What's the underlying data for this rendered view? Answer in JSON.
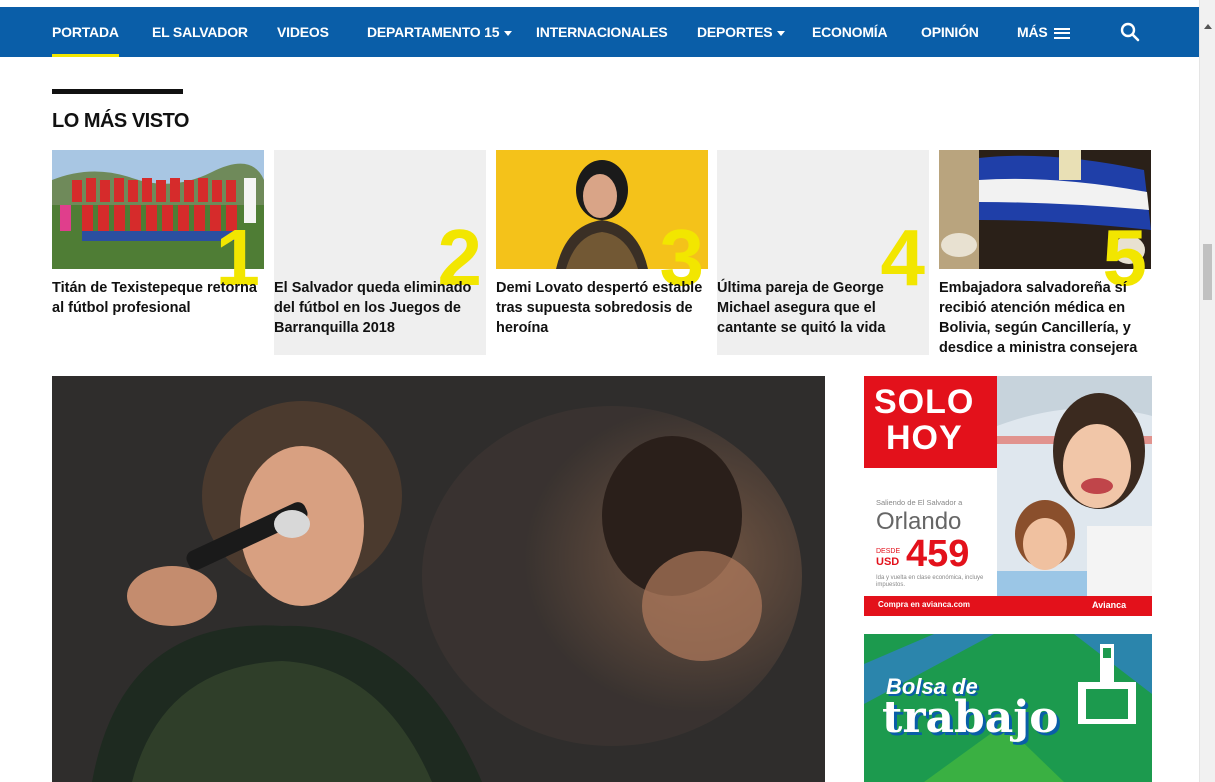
{
  "nav": {
    "items": [
      "PORTADA",
      "EL SALVADOR",
      "VIDEOS",
      "DEPARTAMENTO 15",
      "INTERNACIONALES",
      "DEPORTES",
      "ECONOMÍA",
      "OPINIÓN",
      "MÁS"
    ],
    "active": "PORTADA"
  },
  "section": {
    "title": "LO MÁS VISTO"
  },
  "cards": [
    {
      "rank": "1",
      "caption": "Titán de Texistepeque retorna al fútbol profesional"
    },
    {
      "rank": "2",
      "caption": "El Salvador queda eliminado del fútbol en los Juegos de Barranquilla 2018"
    },
    {
      "rank": "3",
      "caption": "Demi Lovato despertó estable tras supuesta sobredosis de heroína"
    },
    {
      "rank": "4",
      "caption": "Última pareja de George Michael asegura que el cantante se quitó la vida"
    },
    {
      "rank": "5",
      "caption": "Embajadora salvadoreña sí recibió atención médica en Bolivia, según Cancillería, y desdice a ministra consejera"
    }
  ],
  "ads": {
    "avianca": {
      "headline_1": "SOLO",
      "headline_2": "HOY",
      "route": "Saliendo de El Salvador a",
      "city": "Orlando",
      "from_label": "DESDE",
      "currency": "USD",
      "price": "459",
      "fine_print": "Ida y vuelta en clase económica, incluye impuestos.",
      "cta": "Compra en avianca.com",
      "brand": "Avianca"
    },
    "bolsa": {
      "line_1": "Bolsa de",
      "line_2": "trabajo"
    }
  },
  "colors": {
    "nav_bg": "#0a5ea8",
    "accent_yellow": "#f2e600",
    "avianca_red": "#e3111b"
  }
}
